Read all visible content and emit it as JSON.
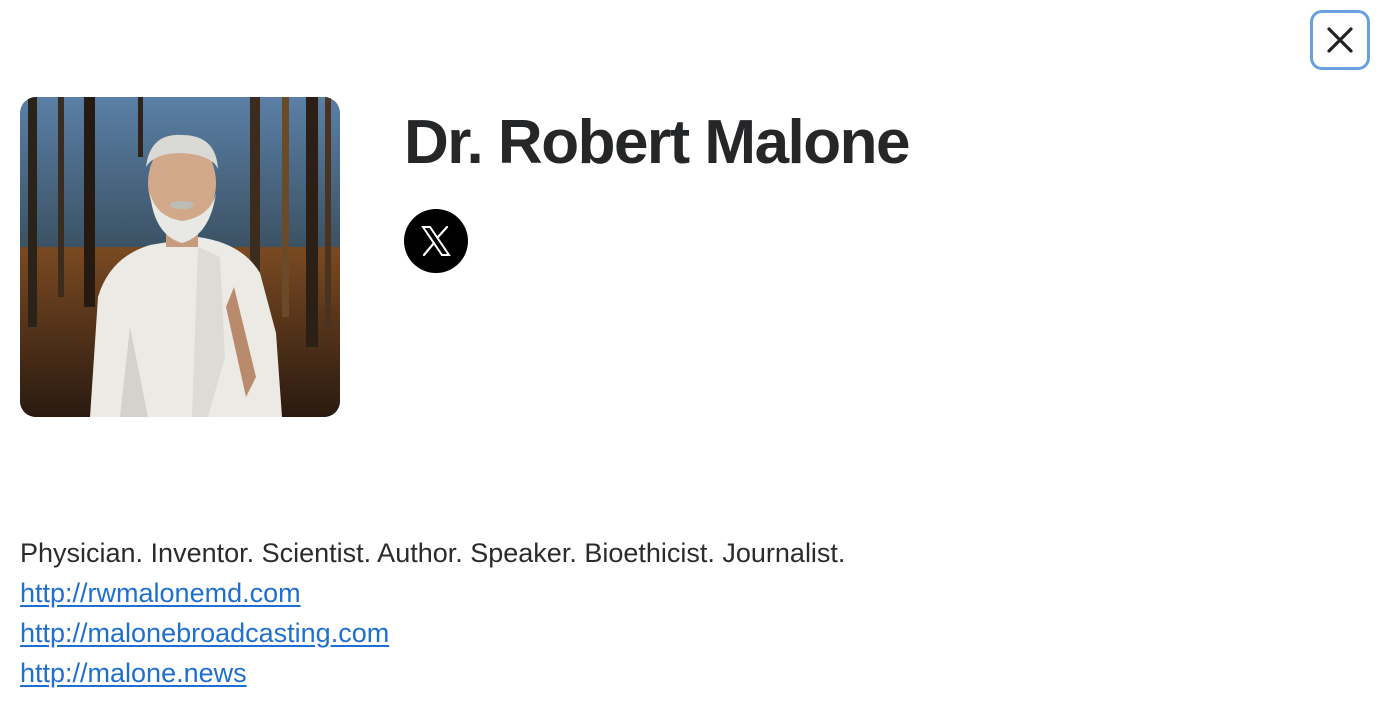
{
  "profile": {
    "name": "Dr. Robert Malone",
    "avatar_icon": "profile-photo",
    "social": [
      {
        "icon": "x-logo-icon",
        "label": "X"
      }
    ],
    "bio": "Physician. Inventor. Scientist. Author. Speaker. Bioethicist. Journalist.",
    "links": [
      "http://rwmalonemd.com",
      "http://malonebroadcasting.com",
      "http://malone.news"
    ]
  },
  "close_button": {
    "icon": "close-icon"
  },
  "colors": {
    "link": "#1f6fd1",
    "close_border": "#6aa0e0",
    "name_text": "#252628",
    "social_bg": "#000000"
  }
}
